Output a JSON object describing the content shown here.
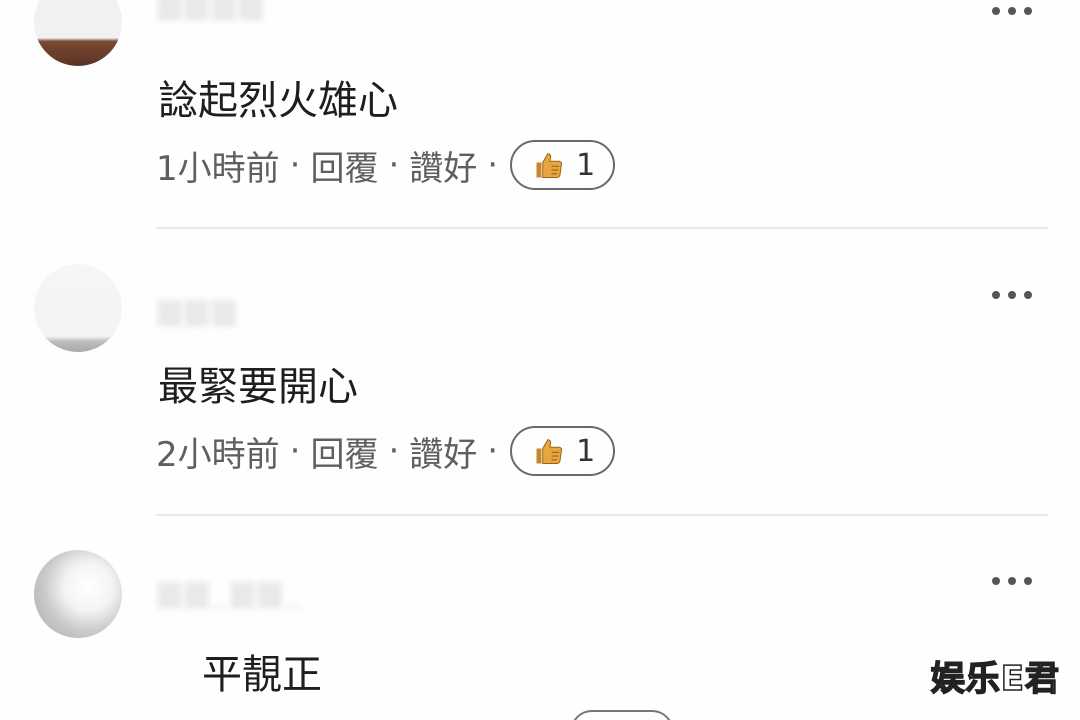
{
  "comments": [
    {
      "text": "諗起烈火雄心",
      "time": "1小時前",
      "reply_label": "回覆",
      "like_label": "讚好",
      "reaction_count": "1"
    },
    {
      "text": "最緊要開心",
      "time": "2小時前",
      "reply_label": "回覆",
      "like_label": "讚好",
      "reaction_count": "1"
    },
    {
      "text": "平靚正"
    }
  ],
  "separator": "·",
  "watermark": "娱乐E君",
  "colors": {
    "text": "#1e1e1e",
    "meta": "#5f5f5f",
    "thumb": "#e8a640",
    "divider": "#e8e8e8"
  },
  "icons": {
    "reaction": "thumbs-up-icon",
    "menu": "more-options-icon"
  }
}
